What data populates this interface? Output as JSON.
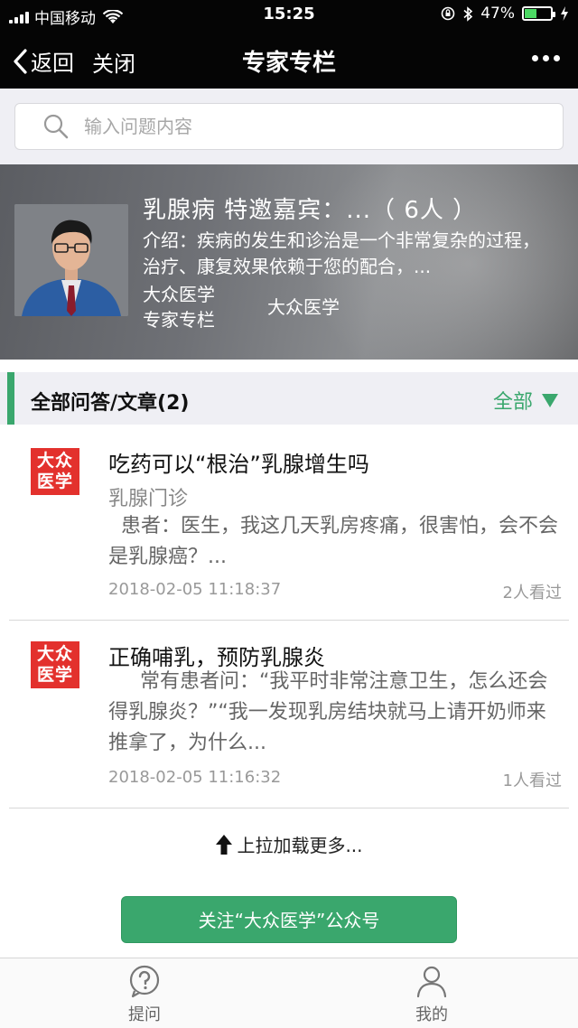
{
  "status_bar": {
    "carrier": "中国移动",
    "time": "15:25",
    "battery_percent": "47%",
    "battery_level": 0.47
  },
  "nav": {
    "back_label": "返回",
    "close_label": "关闭",
    "title": "专家专栏",
    "more_icon": "more-dots-icon"
  },
  "search": {
    "placeholder": "输入问题内容"
  },
  "banner": {
    "title": "乳腺病 特邀嘉宾：...（ 6人 ）",
    "description": "介绍：疾病的发生和诊治是一个非常复杂的过程，治疗、康复效果依赖于您的配合，...",
    "source_line1": "大众医学",
    "source_line2": "专家专栏",
    "source_right": "大众医学"
  },
  "section": {
    "label": "全部问答/文章(2)",
    "filter_label": "全部",
    "accent_color": "#3aa76d"
  },
  "items": [
    {
      "logo_text_1": "大众",
      "logo_text_2": "医学",
      "title": "吃药可以“根治”乳腺增生吗",
      "category": "乳腺门诊",
      "excerpt": "  患者：医生，我这几天乳房疼痛，很害怕，会不会是乳腺癌？...",
      "date": "2018-02-05 11:18:37",
      "views": "2人看过"
    },
    {
      "logo_text_1": "大众",
      "logo_text_2": "医学",
      "title": "正确哺乳，预防乳腺炎",
      "category": "",
      "excerpt": "     常有患者问：“我平时非常注意卫生，怎么还会得乳腺炎？”“我一发现乳房结块就马上请开奶师来推拿了，为什么...",
      "date": "2018-02-05 11:16:32",
      "views": "1人看过"
    }
  ],
  "load_more": "上拉加载更多...",
  "follow_button": "关注“大众医学”公众号",
  "tabs": [
    {
      "label": "提问",
      "icon": "question-icon"
    },
    {
      "label": "我的",
      "icon": "user-icon"
    }
  ]
}
